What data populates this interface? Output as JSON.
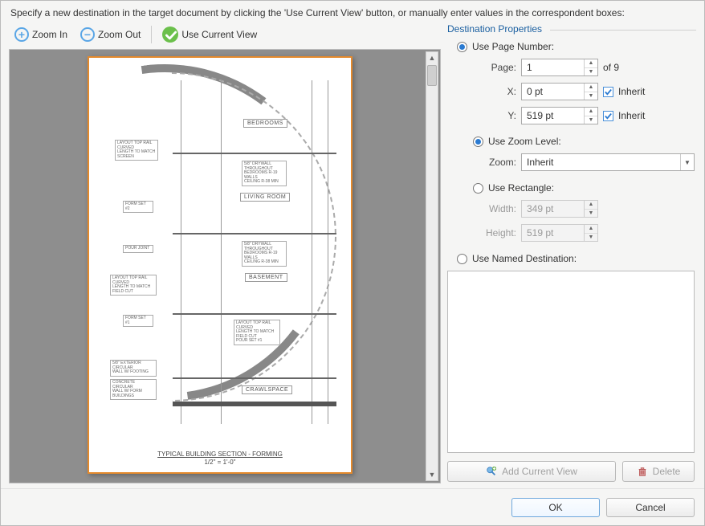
{
  "instruction": "Specify a new destination in the target document by clicking the 'Use Current View' button, or manually enter values in the correspondent boxes:",
  "toolbar": {
    "zoom_in": "Zoom In",
    "zoom_out": "Zoom Out",
    "use_current_view": "Use Current View"
  },
  "preview": {
    "title": "TYPICAL BUILDING SECTION - FORMING",
    "scale": "1/2\" = 1'-0\"",
    "rooms": {
      "r1": "BEDROOMS",
      "r2": "LIVING ROOM",
      "r3": "BASEMENT",
      "r4": "CRAWLSPACE"
    }
  },
  "props": {
    "group_title": "Destination Properties",
    "use_page_number": {
      "label": "Use Page Number:",
      "selected": true
    },
    "page_label": "Page:",
    "page_value": "1",
    "of_text": "of 9",
    "x_label": "X:",
    "x_value": "0 pt",
    "y_label": "Y:",
    "y_value": "519 pt",
    "inherit_label": "Inherit",
    "inherit_x": true,
    "inherit_y": true,
    "use_zoom": {
      "label": "Use Zoom Level:",
      "selected": true
    },
    "zoom_label": "Zoom:",
    "zoom_value": "Inherit",
    "use_rect": {
      "label": "Use Rectangle:",
      "selected": false
    },
    "width_label": "Width:",
    "width_value": "349 pt",
    "height_label": "Height:",
    "height_value": "519 pt",
    "use_named": {
      "label": "Use Named Destination:",
      "selected": false
    },
    "add_current_view": "Add Current View",
    "delete": "Delete"
  },
  "footer": {
    "ok": "OK",
    "cancel": "Cancel"
  }
}
